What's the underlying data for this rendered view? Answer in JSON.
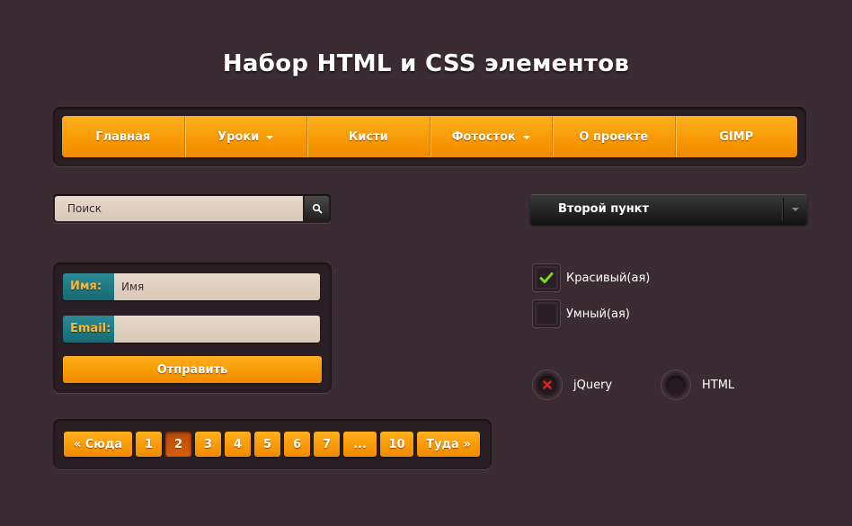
{
  "page": {
    "title": "Набор HTML и CSS элементов"
  },
  "nav": {
    "items": [
      {
        "label": "Главная",
        "dropdown": false
      },
      {
        "label": "Уроки",
        "dropdown": true
      },
      {
        "label": "Кисти",
        "dropdown": false
      },
      {
        "label": "Фотосток",
        "dropdown": true
      },
      {
        "label": "О проекте",
        "dropdown": false
      },
      {
        "label": "GIMP",
        "dropdown": false
      }
    ]
  },
  "search": {
    "placeholder": "Поиск",
    "icon": "search-icon"
  },
  "select": {
    "selected": "Второй пункт"
  },
  "form": {
    "name_label": "Имя:",
    "name_placeholder": "Имя",
    "email_label": "Email:",
    "email_placeholder": "",
    "submit_label": "Отправить"
  },
  "checkboxes": [
    {
      "label": "Красивый(ая)",
      "checked": true
    },
    {
      "label": "Умный(ая)",
      "checked": false
    }
  ],
  "radios": [
    {
      "label": "jQuery",
      "selected": true
    },
    {
      "label": "HTML",
      "selected": false
    }
  ],
  "pagination": {
    "prev_label": "« Сюда",
    "pages": [
      "1",
      "2",
      "3",
      "4",
      "5",
      "6",
      "7",
      "...",
      "10"
    ],
    "active_page": "2",
    "next_label": "Туда »"
  },
  "colors": {
    "background": "#3b2c33",
    "accent_orange": "#f89a05",
    "label_teal": "#1f7a85",
    "check_green": "#7ed321",
    "radio_red": "#e02020"
  }
}
